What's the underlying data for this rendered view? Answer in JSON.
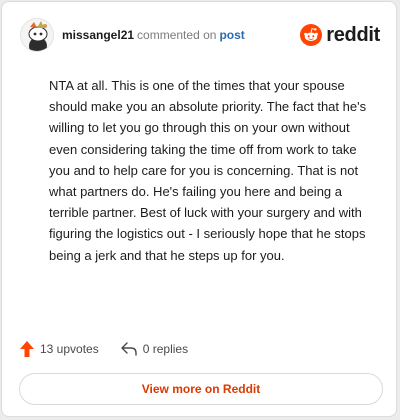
{
  "comment": {
    "username": "missangel21",
    "action_text": "commented on",
    "post_link": "post",
    "text": "NTA at all. This is one of the times that your spouse should make you an absolute priority. The fact that he's willing to let you go through this on your own without even considering taking the time off from work to take you and to help care for you is concerning. That is not what partners do. He's failing you here and being a terrible partner. Best of luck with your surgery and with figuring the logistics out - I seriously hope that he stops being a jerk and that he steps up for you.",
    "upvotes": "13 upvotes",
    "replies": "0 replies"
  },
  "brand": {
    "name": "reddit",
    "color": "#ff4500"
  },
  "actions": {
    "view_more_label": "View more on Reddit"
  },
  "colors": {
    "upvote": "#ff4500",
    "link": "#2b6cb0",
    "view_more": "#d93a00"
  }
}
